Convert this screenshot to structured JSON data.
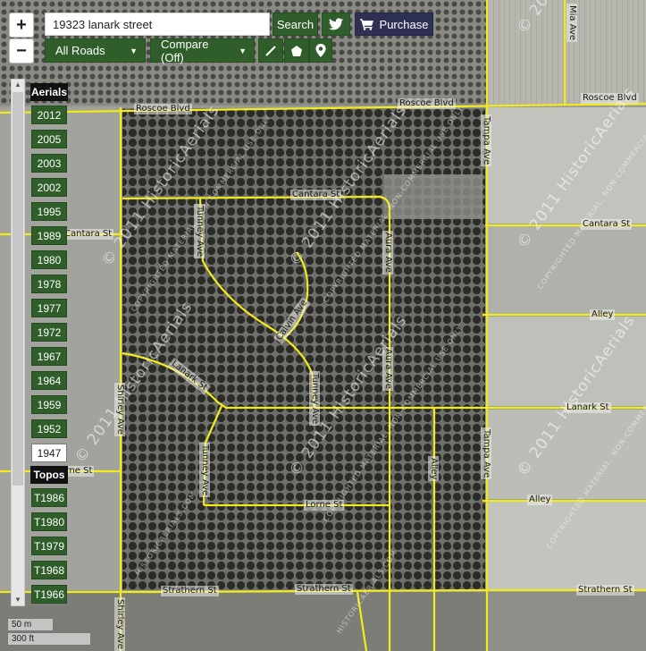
{
  "search": {
    "value": "19323 lanark street",
    "button_label": "Search"
  },
  "zoom": {
    "in_label": "+",
    "out_label": "−"
  },
  "toolbar": {
    "purchase_label": "Purchase",
    "roads_select": "All Roads",
    "compare_select": "Compare (Off)"
  },
  "sidebar": {
    "aerials_header": "Aerials",
    "aerial_years": [
      "2012",
      "2005",
      "2003",
      "2002",
      "1995",
      "1989",
      "1980",
      "1978",
      "1977",
      "1972",
      "1967",
      "1964",
      "1959",
      "1952",
      "1947"
    ],
    "selected_year": "1947",
    "topos_header": "Topos",
    "topo_years": [
      "T1986",
      "T1980",
      "T1979",
      "T1968",
      "T1966"
    ]
  },
  "scale": {
    "metric": "50 m",
    "imperial": "300 ft"
  },
  "roads": {
    "roscoe1": "Roscoe Blvd",
    "roscoe2": "Roscoe Blvd",
    "roscoe3": "Roscoe Blvd",
    "cantara1": "Cantara St",
    "cantara2": "Cantara St",
    "cantara3": "Cantara St",
    "tunney1": "Tunney Ave",
    "tunney2": "Tunney Ave",
    "tunney3": "Tunney Ave",
    "calvin": "Calvin Ave",
    "lanark1": "Lanark St",
    "lanark2": "Lanark St",
    "aura": "Aura Ave",
    "shirley1": "Shirley Ave",
    "shirley2": "Shirley Ave",
    "tampa1": "Tampa Ave",
    "tampa2": "Tampa Ave",
    "alley1": "Alley",
    "alley2": "Alley",
    "alley3": "Alley",
    "lorne1": "Lorne St",
    "lorne2": "Lorne St",
    "strathern1": "Strathern St",
    "strathern2": "Strathern St",
    "strathern3": "Strathern St",
    "mia": "Mia Ave"
  },
  "watermark": {
    "main": "© 2011 HistoricAerials",
    "sub": "COPYRIGHTED MATERIAL, NON-COMMERCIAL USE ONLY",
    "site": "HISTORICAERIALS.COM"
  }
}
